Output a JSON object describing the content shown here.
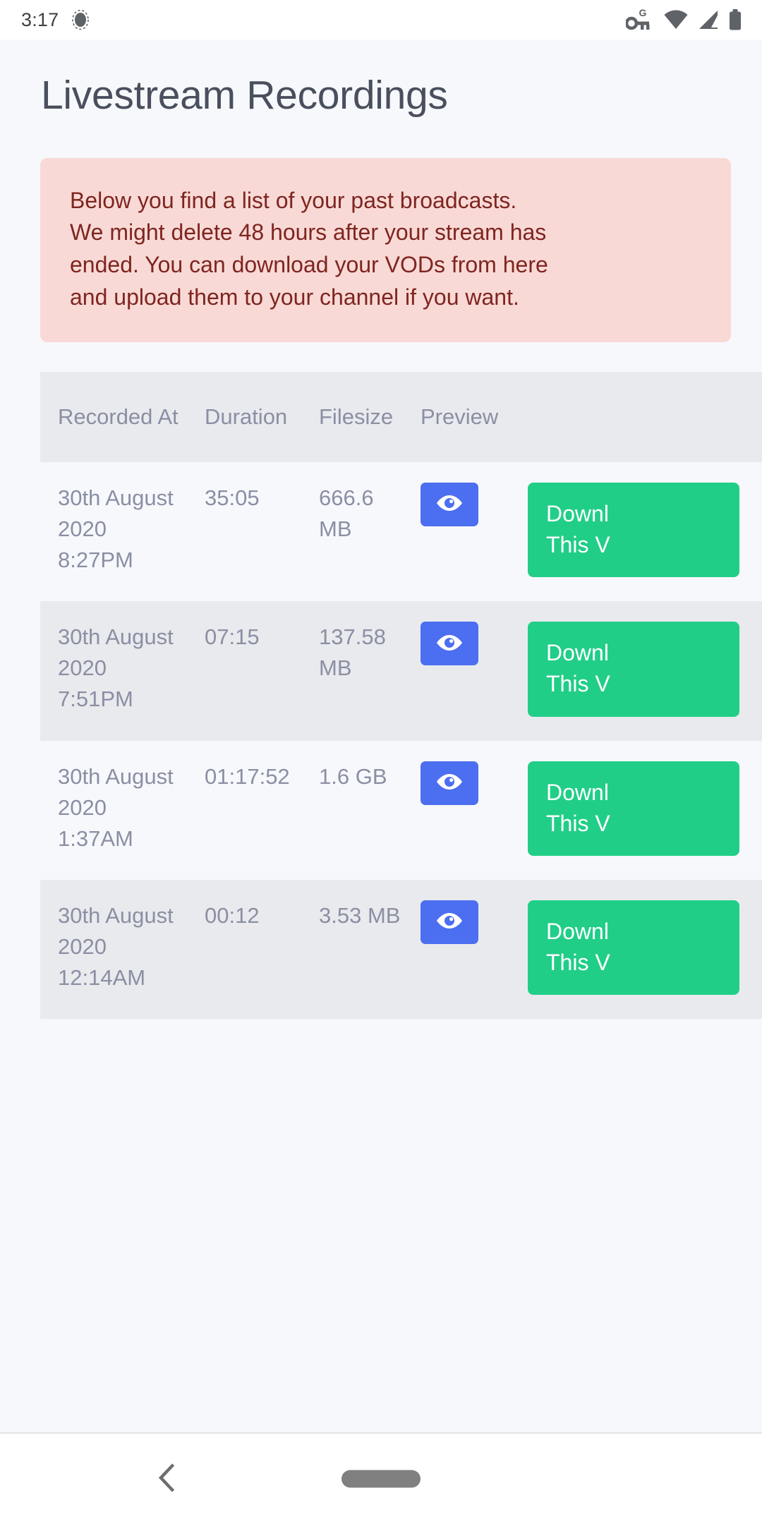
{
  "status_bar": {
    "time": "3:17",
    "left_icons": [
      "notification-dot-icon"
    ],
    "right_icons": [
      "vpn-key-g-icon",
      "wifi-icon",
      "cellular-signal-icon",
      "battery-icon"
    ]
  },
  "page": {
    "title": "Livestream Recordings",
    "title_color": "#4a4f5e",
    "background_color": "#f7f8fc"
  },
  "alert": {
    "background_color": "#f9d9d5",
    "text_color": "#7e2520",
    "lines": [
      "Below you find a list of your past broadcasts.",
      "We might delete 48 hours after your stream has",
      "ended. You can download your VODs from here",
      "and upload them to your channel if you want."
    ]
  },
  "table": {
    "header_background": "#e9eaee",
    "header_text_color": "#8a8fa3",
    "columns": [
      "Recorded At",
      "Duration",
      "Filesize",
      "Preview",
      ""
    ],
    "rows": [
      {
        "recorded_at": "30th August 2020 8:27PM",
        "duration": "35:05",
        "filesize": "666.6 MB",
        "preview_icon": "eye-icon",
        "download_line1": "Downl",
        "download_line2": "This V",
        "download_full": "Download This VOD"
      },
      {
        "recorded_at": "30th August 2020 7:51PM",
        "duration": "07:15",
        "filesize": "137.58 MB",
        "preview_icon": "eye-icon",
        "download_line1": "Downl",
        "download_line2": "This V",
        "download_full": "Download This VOD"
      },
      {
        "recorded_at": "30th August 2020 1:37AM",
        "duration": "01:17:52",
        "filesize": "1.6 GB",
        "preview_icon": "eye-icon",
        "download_line1": "Downl",
        "download_line2": "This V",
        "download_full": "Download This VOD"
      },
      {
        "recorded_at": "30th August 2020 12:14AM",
        "duration": "00:12",
        "filesize": "3.53 MB",
        "preview_icon": "eye-icon",
        "download_line1": "Downl",
        "download_line2": "This V",
        "download_full": "Download This VOD"
      }
    ],
    "preview_button_color": "#4c6ef0",
    "download_button_color": "#21ce87"
  },
  "nav_bar": {
    "back_icon": "chevron-left-icon",
    "home_indicator": "home-pill-icon"
  }
}
